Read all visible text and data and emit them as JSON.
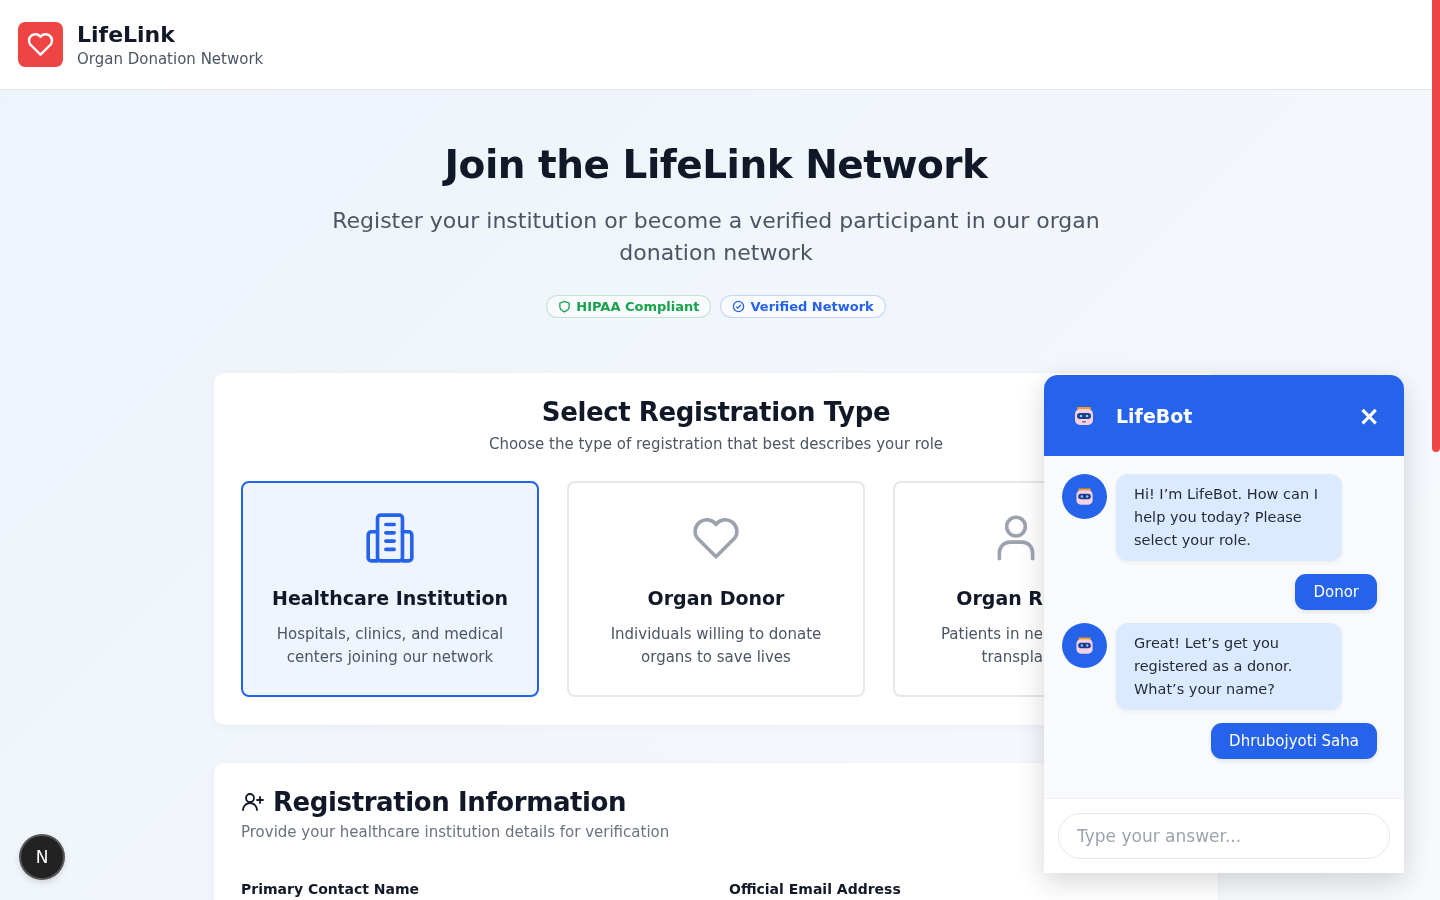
{
  "header": {
    "logo_title": "LifeLink",
    "logo_subtitle": "Organ Donation Network"
  },
  "hero": {
    "title": "Join the LifeLink Network",
    "subtitle": "Register your institution or become a verified participant in our organ donation network",
    "badges": [
      {
        "kind": "shield",
        "label": "HIPAA Compliant",
        "color": "#16a34a"
      },
      {
        "kind": "check",
        "label": "Verified Network",
        "color": "#2563eb"
      }
    ]
  },
  "registration_type": {
    "title": "Select Registration Type",
    "subtitle": "Choose the type of registration that best describes your role",
    "cards": [
      {
        "kind": "building",
        "clipped": false,
        "title": "Healthcare Institution",
        "desc_lines": [
          "Hospitals, clinics, and medical",
          "centers joining our network"
        ],
        "selected": true
      },
      {
        "kind": "heart",
        "clipped": false,
        "title": "Organ Donor",
        "desc_lines": [
          "Individuals willing to donate",
          "organs to save lives"
        ],
        "selected": false
      },
      {
        "kind": "person",
        "clipped": true,
        "title": "Organ R",
        "desc_lines": [
          "Patients in ne",
          "transpla"
        ],
        "selected": false
      }
    ]
  },
  "registration_info": {
    "title": "Registration Information",
    "subtitle": "Provide your healthcare institution details for verification",
    "field_labels": [
      "Primary Contact Name",
      "Official Email Address"
    ]
  },
  "dev_badge": "N",
  "chat": {
    "title": "LifeBot",
    "close": "×",
    "messages": [
      {
        "kind": "bot",
        "text": "Hi! I’m LifeBot. How can I help you today? Please select your role."
      },
      {
        "kind": "user",
        "text": "Donor"
      },
      {
        "kind": "bot",
        "text": "Great! Let’s get you registered as a donor. What’s your name?"
      },
      {
        "kind": "user",
        "text": "Dhrubojyoti Saha"
      }
    ],
    "input": {
      "placeholder": "Type your answer..."
    }
  }
}
